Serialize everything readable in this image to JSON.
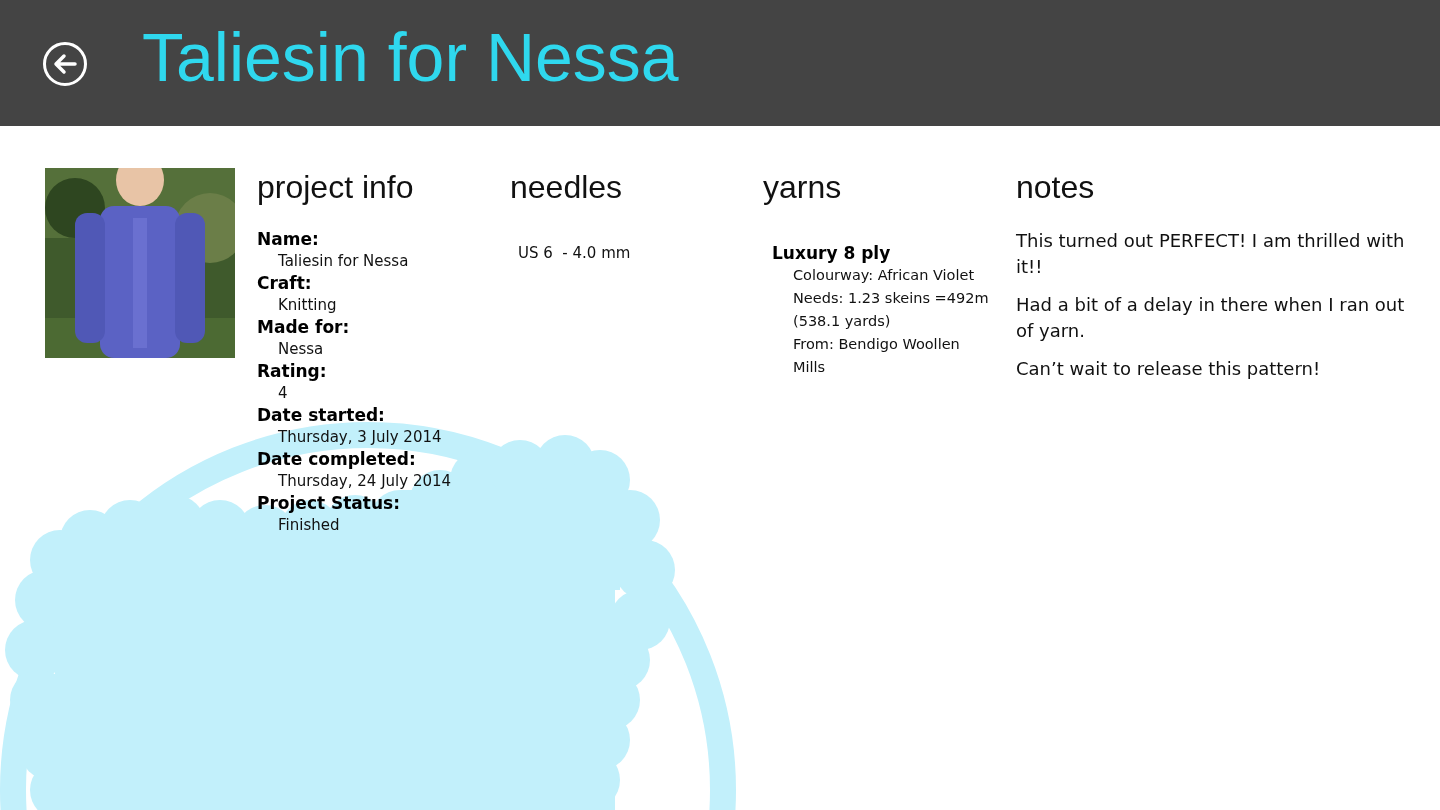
{
  "header": {
    "title": "Taliesin for Nessa"
  },
  "project_info": {
    "heading": "project info",
    "fields": [
      {
        "label": "Name:",
        "value": "Taliesin for Nessa"
      },
      {
        "label": "Craft:",
        "value": "Knitting"
      },
      {
        "label": "Made for:",
        "value": "Nessa"
      },
      {
        "label": "Rating:",
        "value": "4"
      },
      {
        "label": "Date started:",
        "value": "Thursday, 3 July 2014"
      },
      {
        "label": "Date completed:",
        "value": "Thursday, 24 July 2014"
      },
      {
        "label": "Project Status:",
        "value": "Finished"
      }
    ]
  },
  "needles": {
    "heading": "needles",
    "items": [
      "US 6  - 4.0 mm"
    ]
  },
  "yarns": {
    "heading": "yarns",
    "items": [
      {
        "name": "Luxury 8 ply",
        "details": [
          "Colourway: African Violet",
          "Needs: 1.23 skeins =492m (538.1 yards)",
          "From: Bendigo Woollen Mills"
        ]
      }
    ]
  },
  "notes": {
    "heading": "notes",
    "paragraphs": [
      "This turned out PERFECT! I am thrilled with it!!",
      "Had a bit of a delay in there when I ran out of yarn.",
      "Can’t wait to release this pattern!"
    ]
  }
}
